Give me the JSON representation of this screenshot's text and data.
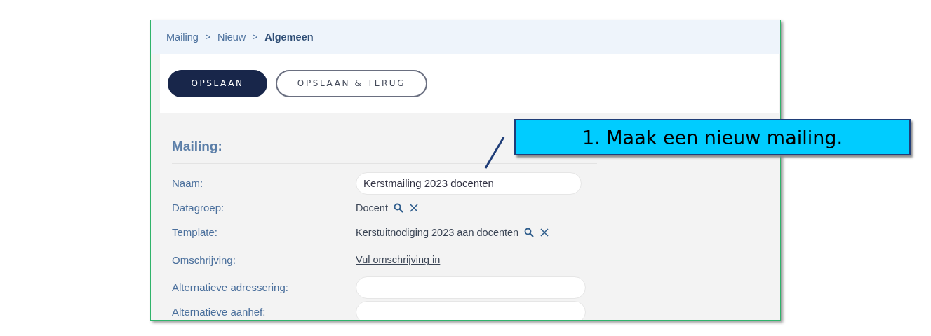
{
  "breadcrumb": [
    {
      "label": "Mailing",
      "current": false
    },
    {
      "label": "Nieuw",
      "current": false
    },
    {
      "label": "Algemeen",
      "current": true
    }
  ],
  "breadcrumb_separators": [
    ">",
    ">"
  ],
  "buttons": [
    {
      "label": "OPSLAAN",
      "kind": "primary"
    },
    {
      "label": "OPSLAAN & TERUG",
      "kind": "secondary"
    }
  ],
  "section_title": "Mailing:",
  "fields": [
    {
      "label": "Naam:",
      "kind": "input",
      "value": "Kerstmailing 2023 docenten"
    },
    {
      "label": "Datagroep:",
      "kind": "lookup",
      "value": "Docent"
    },
    {
      "label": "Template:",
      "kind": "lookup",
      "value": "Kerstuitnodiging 2023 aan docenten"
    },
    {
      "label": "Omschrijving:",
      "kind": "link",
      "value": "Vul omschrijving in"
    },
    {
      "label": "Alternatieve adressering:",
      "kind": "input"
    },
    {
      "label": "Alternatieve aanhef:",
      "kind": "input"
    }
  ],
  "callout": {
    "text": "1. Maak een nieuw mailing."
  }
}
